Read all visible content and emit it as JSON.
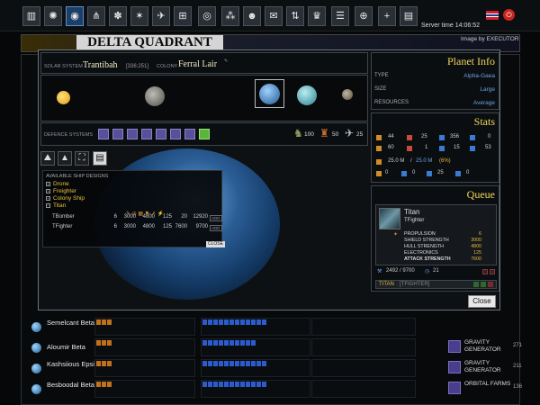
{
  "topbar": {
    "icons": [
      "stats-icon",
      "galaxy-icon",
      "planets-icon",
      "fleet-icon",
      "research-icon",
      "combat-icon",
      "shipyard-icon",
      "defense-icon",
      "spy-icon",
      "network-icon",
      "alliance-icon",
      "mail-icon",
      "trade-icon",
      "trophy-icon",
      "list-icon",
      "world-icon",
      "add-icon",
      "notebook-icon"
    ],
    "server_time": "Server time 14:06:52"
  },
  "banner": {
    "title": "DELTA QUADRANT",
    "credit": "Image by EXECUTOR"
  },
  "background_list": {
    "systems": [
      {
        "name": "Semelcant Beta",
        "module": "",
        "count": ""
      },
      {
        "name": "Aloumir Beta",
        "module": "GRAVITY GENERATOR",
        "count": "271"
      },
      {
        "name": "Kashsiious Epsilon",
        "module": "GRAVITY GENERATOR",
        "count": "211"
      },
      {
        "name": "Besboodal Beta",
        "module": "ORBITAL FARMS",
        "count": "136"
      }
    ]
  },
  "modal": {
    "solar_system_label": "SOLAR SYSTEM",
    "solar_system": "Trantibah",
    "coords": "[336:251]",
    "colony_label": "COLONY",
    "colony": "Ferral Lair",
    "defence_label": "DEFENCE SYSTEMS",
    "defence_counts": [
      "100",
      "50",
      "25"
    ],
    "ship_designs_title": "AVAILABLE SHIP DESIGNS",
    "design_tree": [
      "Drone",
      "Freighter",
      "Colony Ship",
      "Titan"
    ],
    "designs": [
      {
        "name": "TBomber",
        "v1": "6",
        "v2": "3000",
        "v3": "4800",
        "v4": "125",
        "v5": "20",
        "v6": "12920",
        "add": "ADD"
      },
      {
        "name": "TFighter",
        "v1": "6",
        "v2": "3000",
        "v3": "4800",
        "v4": "125",
        "v5": "7600",
        "v6": "9700",
        "add": "ADD"
      }
    ],
    "close_small": "CLOSE",
    "close": "Close"
  },
  "planet_info": {
    "title": "Planet Info",
    "type_label": "TYPE",
    "type": "Alpha-Gaea",
    "size_label": "SIZE",
    "size": "Large",
    "resources_label": "RESOURCES",
    "resources": "Average"
  },
  "stats": {
    "title": "Stats",
    "row1": [
      "44",
      "25",
      "356",
      "0"
    ],
    "row2": [
      "60",
      "1",
      "15",
      "53"
    ],
    "population": "25.0 M",
    "population_max": "25.0 M",
    "growth": "(6%)",
    "row4": [
      "0",
      "0",
      "25",
      "0"
    ]
  },
  "queue": {
    "title": "Queue",
    "ship": "Titan",
    "design": "TFighter",
    "stats": [
      {
        "label": "PROPULSION",
        "value": "6"
      },
      {
        "label": "SHIELD STRENGTH",
        "value": "3000"
      },
      {
        "label": "HULL STRENGTH",
        "value": "4800"
      },
      {
        "label": "ELECTRONICS",
        "value": "125"
      },
      {
        "label": "ATTACK STRENGTH",
        "value": "7600"
      }
    ],
    "progress": "2492 / 9700",
    "turns": "21",
    "queued": "TITAN",
    "queued_design": "[TFIGHTER]"
  }
}
